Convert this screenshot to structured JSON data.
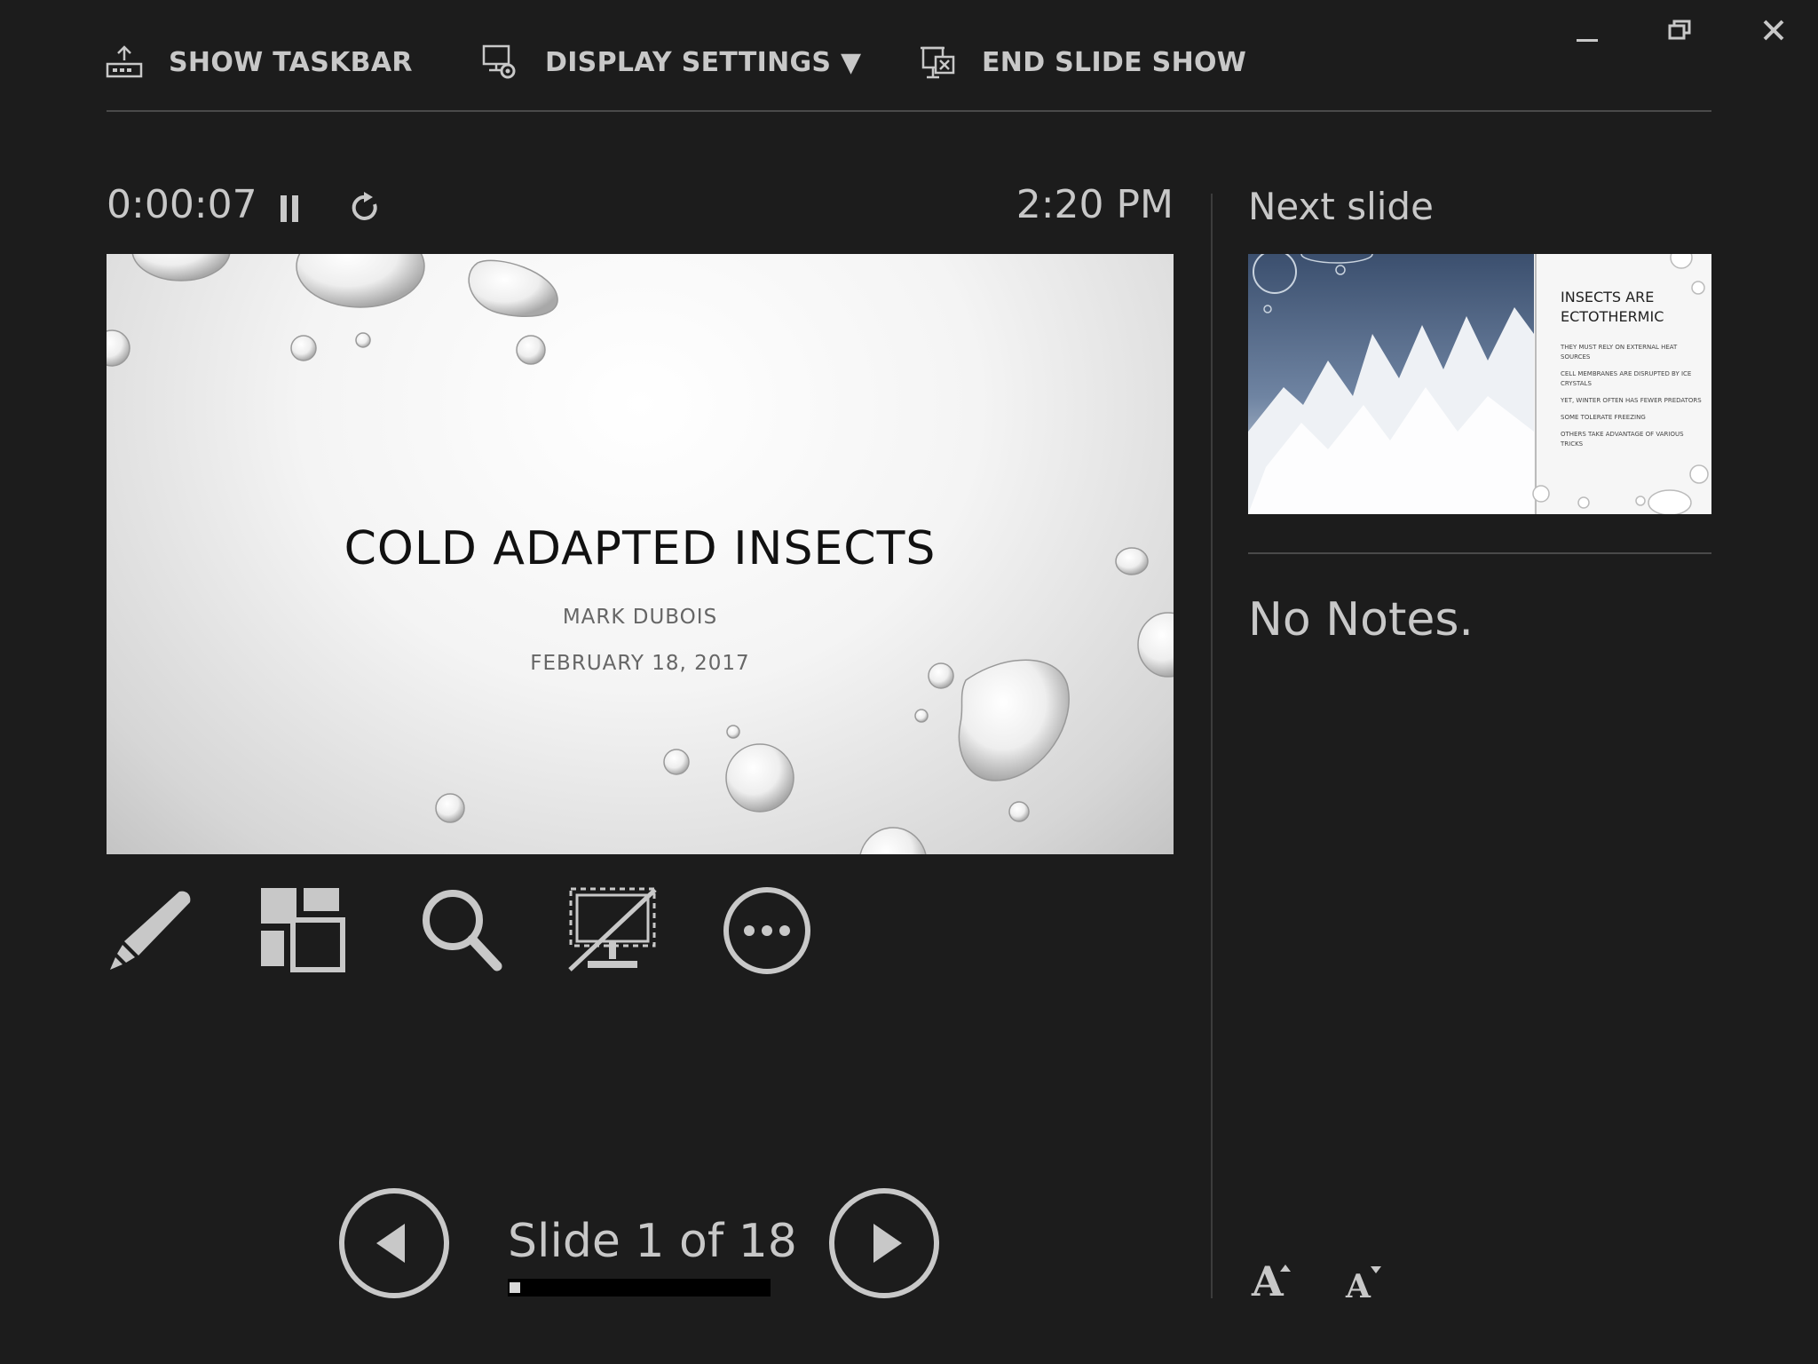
{
  "toolbar": {
    "show_taskbar": "SHOW TASKBAR",
    "display_settings": "DISPLAY SETTINGS ▼",
    "end_slide_show": "END SLIDE SHOW"
  },
  "window_controls": {
    "minimize": "–",
    "restore": "❐",
    "close": "✕"
  },
  "timer": {
    "elapsed": "0:00:07",
    "clock": "2:20 PM",
    "pause_icon": "pause-icon",
    "restart_icon": "restart-icon"
  },
  "current_slide": {
    "title": "COLD ADAPTED INSECTS",
    "author": "MARK DUBOIS",
    "date": "FEBRUARY 18, 2017"
  },
  "next_slide": {
    "label": "Next slide",
    "thumb_title_line1": "INSECTS ARE",
    "thumb_title_line2": "ECTOTHERMIC",
    "thumb_bullets": [
      "THEY MUST RELY ON EXTERNAL HEAT SOURCES",
      "CELL MEMBRANES ARE DISRUPTED BY ICE CRYSTALS",
      "YET, WINTER OFTEN HAS FEWER PREDATORS",
      "SOME TOLERATE FREEZING",
      "OTHERS TAKE ADVANTAGE OF VARIOUS TRICKS"
    ]
  },
  "notes": {
    "text": "No Notes."
  },
  "tools": [
    "pen-icon",
    "see-all-slides-icon",
    "zoom-icon",
    "black-screen-icon",
    "more-options-icon"
  ],
  "navigation": {
    "slide_counter": "Slide 1 of 18",
    "current": 1,
    "total": 18,
    "progress_fraction": 0.0556
  },
  "font_controls": {
    "increase": "A",
    "decrease": "A"
  },
  "colors": {
    "background": "#1c1c1c",
    "foreground": "#c8c8c8",
    "divider": "#4a4a4a"
  }
}
